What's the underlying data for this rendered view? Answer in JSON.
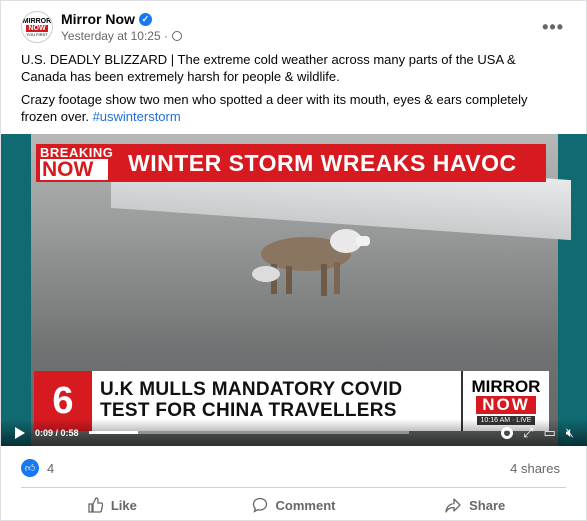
{
  "post": {
    "page_name": "Mirror Now",
    "timestamp": "Yesterday at 10:25 ·",
    "avatar_line1": "MIRROR",
    "avatar_line2": "NOW",
    "avatar_line3": "YOU FIRST",
    "more_label": "•••",
    "paragraph1": "U.S. DEADLY BLIZZARD | The extreme cold weather across many parts of the USA & Canada has been extremely harsh for people & wildlife.",
    "paragraph2": "Crazy footage show two men who spotted a deer with its mouth, eyes & ears completely frozen over.",
    "hashtag": "#uswinterstorm"
  },
  "video": {
    "breaking_line1": "BREAKING",
    "breaking_line2": "NOW",
    "headline": "WINTER STORM WREAKS HAVOC",
    "lower_number": "6",
    "lower_text": "U.K MULLS MANDATORY COVID TEST FOR CHINA TRAVELLERS",
    "brand_line1": "MIRROR",
    "brand_line2": "NOW",
    "brand_line3": "10:16 AM · LIVE",
    "time_display": "0:09 / 0:58",
    "progress_fraction": 0.155
  },
  "stats": {
    "like_count": "4",
    "shares": "4 shares"
  },
  "actions": {
    "like": "Like",
    "comment": "Comment",
    "share": "Share"
  },
  "colors": {
    "accent": "#1877f2",
    "brand_red": "#d71920",
    "hashtag": "#216fdb"
  }
}
